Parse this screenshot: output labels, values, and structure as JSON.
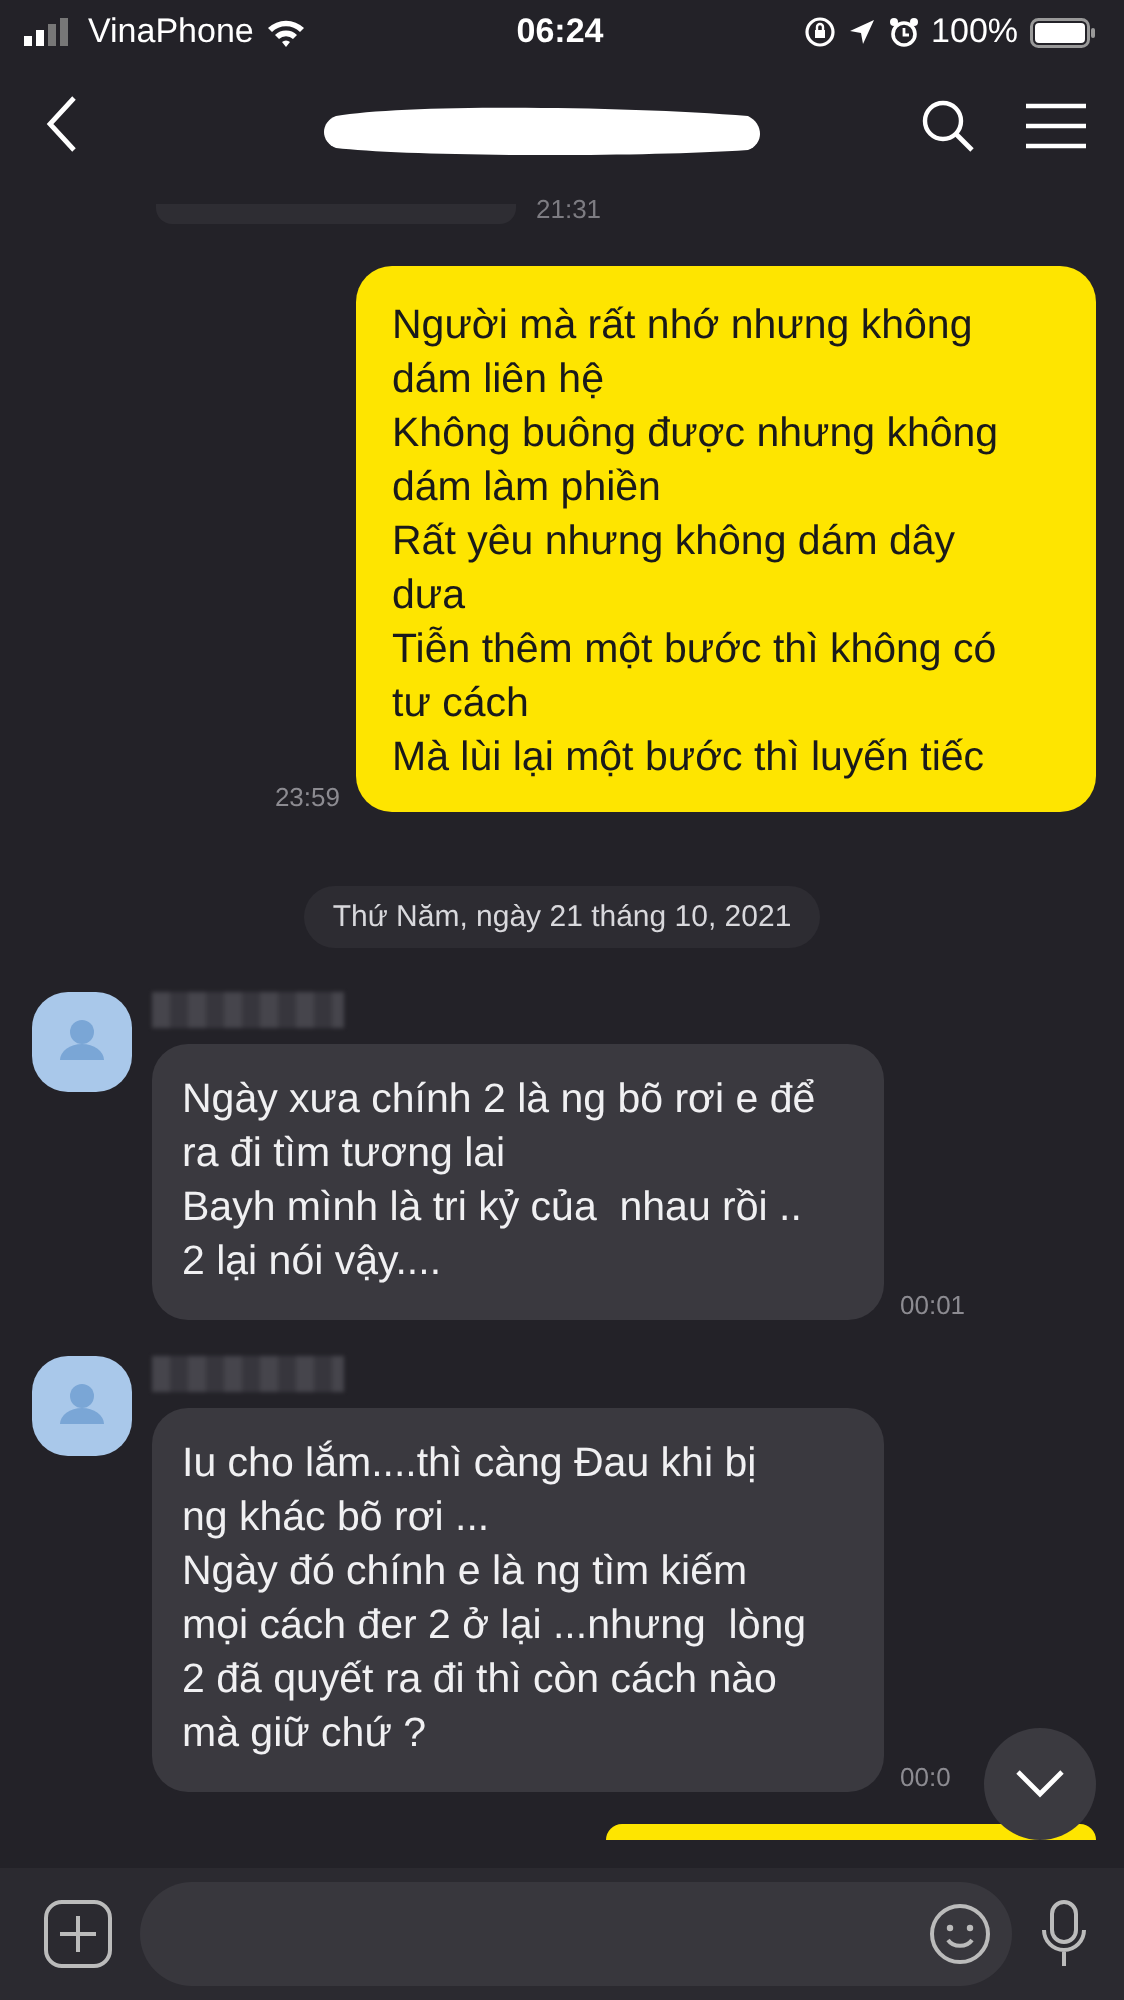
{
  "status_bar": {
    "carrier": "VinaPhone",
    "time": "06:24",
    "battery": "100%"
  },
  "previous_message": {
    "time": "21:31"
  },
  "messages": [
    {
      "kind": "outgoing",
      "text": "Người mà rất nhớ nhưng không\ndám liên hệ\nKhông buông được nhưng không\ndám làm phiền\nRất yêu nhưng không dám dây\ndưa\nTiễn thêm một bước thì không có\ntư cách\nMà lùi lại một bước thì luyến tiếc",
      "time": "23:59"
    },
    {
      "kind": "date",
      "text": "Thứ Năm, ngày 21 tháng 10, 2021"
    },
    {
      "kind": "incoming",
      "text": "Ngày xưa chính 2 là ng bõ rơi e để\nra đi tìm tương lai\nBayh mình là tri kỷ của  nhau rồi ..\n2 lại nói vậy....",
      "time": "00:01"
    },
    {
      "kind": "incoming",
      "text": "Iu cho lắm....thì càng Đau khi bị\nng khác bõ rơi ...\nNgày đó chính e là ng tìm kiếm\nmọi cách đer 2 ở lại ...nhưng  lòng\n2 đã quyết ra đi thì còn cách nào\nmà giữ chứ ?",
      "time": "00:0"
    },
    {
      "kind": "outgoing_cut"
    }
  ]
}
